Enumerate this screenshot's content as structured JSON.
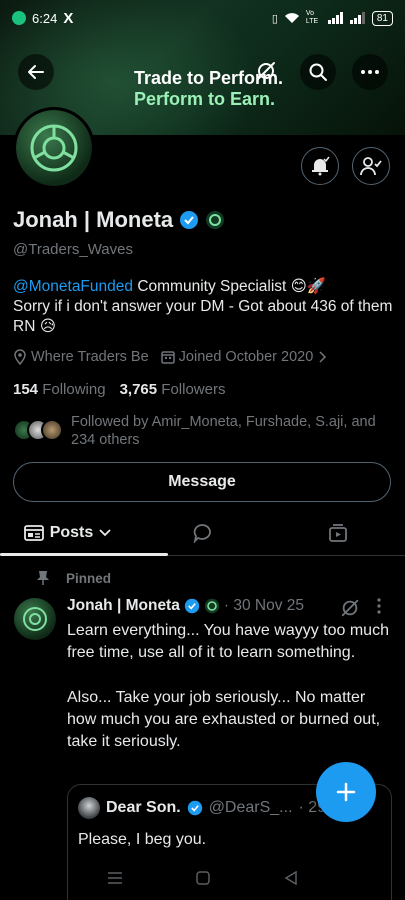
{
  "status_bar": {
    "time": "6:24",
    "x_label": "X",
    "lte_label": "Vo LTE",
    "battery": "81"
  },
  "banner": {
    "line1": "Trade to Perform.",
    "line2": "Perform to Earn."
  },
  "profile": {
    "display_name": "Jonah | Moneta",
    "handle": "@Traders_Waves",
    "bio_mention": "@MonetaFunded",
    "bio_line1_rest": " Community Specialist 😊🚀",
    "bio_line2": "Sorry if i don't answer your DM - Got about 436 of them RN 😥",
    "location": "Where Traders Be",
    "joined": "Joined October 2020",
    "following_count": "154",
    "following_label": "Following",
    "followers_count": "3,765",
    "followers_label": "Followers",
    "followed_by": "Followed by Amir_Moneta, Furshade, S.aji, and 234 others",
    "message_label": "Message"
  },
  "tabs": {
    "posts_label": "Posts"
  },
  "post": {
    "pinned_label": "Pinned",
    "author": "Jonah | Moneta",
    "date": "· 30 Nov 25",
    "text_p1": "Learn everything... You have wayyy too much free time, use all of it to learn something.",
    "text_p2": "Also... Take your job seriously... No matter how much you are exhausted or burned out, take it seriously.",
    "quote": {
      "author": "Dear Son.",
      "handle": "@DearS_...",
      "date": "· 29 ... 25",
      "text": "Please, I beg you."
    }
  },
  "colors": {
    "accent": "#1d9bf0",
    "muted": "#71767b",
    "banner_green": "#9bf0b7"
  },
  "icons": [
    "back-icon",
    "grok-icon",
    "search-icon",
    "more-icon",
    "bell-icon",
    "person-check-icon",
    "verified-badge-icon",
    "location-icon",
    "calendar-icon",
    "chevron-right-icon",
    "posts-icon",
    "chevron-down-icon",
    "replies-icon",
    "media-icon",
    "pin-icon",
    "plus-icon"
  ]
}
